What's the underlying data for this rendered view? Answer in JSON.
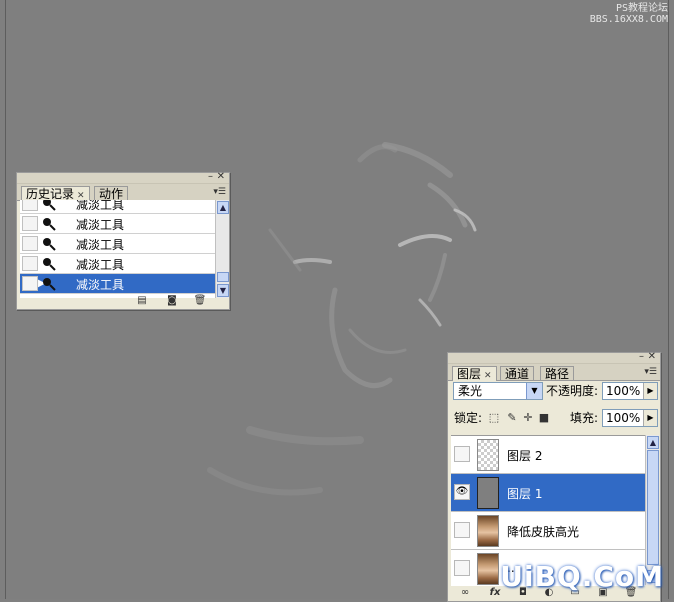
{
  "watermarks": {
    "top_right": [
      "PS教程论坛",
      "BBS.16XX8.COM"
    ],
    "bottom_right": "UiBQ.CoM"
  },
  "history_panel": {
    "tabs": [
      {
        "label": "历史记录",
        "active": true
      },
      {
        "label": "动作",
        "active": false
      }
    ],
    "items": [
      {
        "label": "减淡工具",
        "selected": false
      },
      {
        "label": "减淡工具",
        "selected": false
      },
      {
        "label": "减淡工具",
        "selected": false
      },
      {
        "label": "减淡工具",
        "selected": false
      },
      {
        "label": "减淡工具",
        "selected": true
      }
    ],
    "tool_icon": "dodge-tool-icon",
    "footer_icons": [
      "new-document-from-state-icon",
      "create-snapshot-icon",
      "trash-icon"
    ]
  },
  "layers_panel": {
    "tabs": [
      {
        "label": "图层",
        "active": true
      },
      {
        "label": "通道",
        "active": false
      },
      {
        "label": "路径",
        "active": false
      }
    ],
    "blend_mode": "柔光",
    "opacity_label": "不透明度:",
    "opacity_value": "100%",
    "lock_label": "锁定:",
    "fill_label": "填充:",
    "fill_value": "100%",
    "lock_icons": [
      "lock-transparent-icon",
      "lock-image-icon",
      "lock-position-icon",
      "lock-all-icon"
    ],
    "layers": [
      {
        "name": "图层 2",
        "visible": false,
        "thumb": "transparent",
        "selected": false
      },
      {
        "name": "图层 1",
        "visible": true,
        "thumb": "gray",
        "selected": true
      },
      {
        "name": "降低皮肤高光",
        "visible": false,
        "thumb": "photo",
        "selected": false
      },
      {
        "name": "...",
        "visible": false,
        "thumb": "photo",
        "selected": false
      }
    ],
    "footer_icons": [
      "link-layers-icon",
      "fx-icon",
      "layer-mask-icon",
      "adjustment-layer-icon",
      "new-group-icon",
      "new-layer-icon",
      "trash-icon"
    ],
    "fx_label": "fx"
  },
  "colors": {
    "canvas": "#7f7f7f",
    "panel": "#ece9d8",
    "selection": "#316ac5"
  }
}
